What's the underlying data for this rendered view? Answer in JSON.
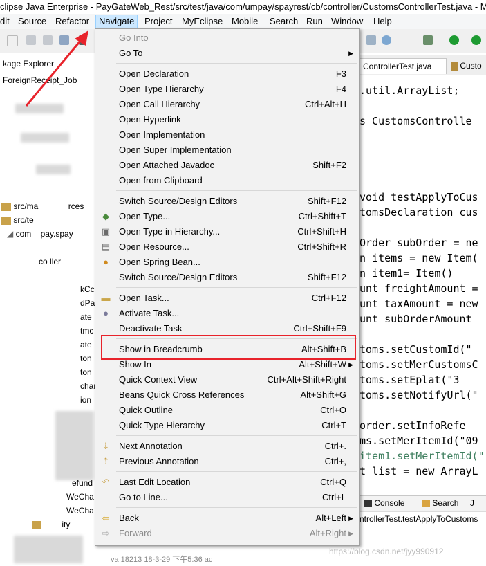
{
  "window": {
    "title": "clipse Java Enterprise - PayGateWeb_Rest/src/test/java/com/umpay/spayrest/cb/controller/CustomsControllerTest.java - M"
  },
  "menubar": {
    "items": [
      {
        "label": "dit"
      },
      {
        "label": "Source"
      },
      {
        "label": "Refactor"
      },
      {
        "label": "Navigate"
      },
      {
        "label": "Project"
      },
      {
        "label": "MyEclipse"
      },
      {
        "label": "Mobile"
      },
      {
        "label": "Search"
      },
      {
        "label": "Run"
      },
      {
        "label": "Window"
      },
      {
        "label": "Help"
      }
    ]
  },
  "package_explorer": {
    "tab_label": "kage Explorer",
    "project": "ForeignReceipt_Job",
    "rows": [
      {
        "label": "src/ma"
      },
      {
        "label": "rces"
      },
      {
        "label": "src/te"
      },
      {
        "label": "com"
      },
      {
        "label": "pay.spay"
      },
      {
        "label": "co"
      },
      {
        "label": "ller"
      },
      {
        "label": "kCc"
      },
      {
        "label": "dPa"
      },
      {
        "label": "ate"
      },
      {
        "label": "tmc"
      },
      {
        "label": "ate"
      },
      {
        "label": "ton"
      },
      {
        "label": "ton"
      },
      {
        "label": "char"
      },
      {
        "label": "ion"
      },
      {
        "label": "efund"
      },
      {
        "label": "WeCha"
      },
      {
        "label": "WeCha"
      },
      {
        "label": "ity"
      }
    ]
  },
  "editor": {
    "tabs": [
      {
        "label": "ControllerTest.java"
      },
      {
        "label": "Custo"
      }
    ],
    "lines": [
      ".util.ArrayList;",
      "s CustomsControlle",
      "void testApplyToCus",
      "tomsDeclaration cus",
      "Order subOrder = ne",
      "n items = new Item(",
      "n item1= Item()",
      "unt freightAmount =",
      "unt taxAmount = new",
      "unt subOrderAmount",
      "toms.setCustomId(\"",
      "toms.setMerCustomsC",
      "toms.setEplat(\"3",
      "toms.setNotifyUrl(\"",
      "order.setInfoRefe",
      "ms.setMerItemId(\"09",
      "item1.setMerItemId(\"",
      "t list = new ArrayL"
    ]
  },
  "console": {
    "tabs": [
      {
        "label": "Console"
      },
      {
        "label": "Search"
      },
      {
        "label": "J"
      }
    ],
    "line": "ntrollerTest.testApplyToCustoms"
  },
  "status": {
    "text": "va 18213 18-3-29 下午5:36 ac"
  },
  "watermark": "https://blog.csdn.net/jyy990912",
  "navigate_menu": {
    "groups": [
      [
        {
          "label": "Go Into",
          "shortcut": "",
          "disabled": true,
          "submenu": false,
          "icon": ""
        },
        {
          "label": "Go To",
          "shortcut": "",
          "disabled": false,
          "submenu": true,
          "icon": ""
        }
      ],
      [
        {
          "label": "Open Declaration",
          "shortcut": "F3",
          "icon": ""
        },
        {
          "label": "Open Type Hierarchy",
          "shortcut": "F4",
          "icon": ""
        },
        {
          "label": "Open Call Hierarchy",
          "shortcut": "Ctrl+Alt+H",
          "icon": ""
        },
        {
          "label": "Open Hyperlink",
          "shortcut": "",
          "icon": ""
        },
        {
          "label": "Open Implementation",
          "shortcut": "",
          "icon": ""
        },
        {
          "label": "Open Super Implementation",
          "shortcut": "",
          "icon": ""
        },
        {
          "label": "Open Attached Javadoc",
          "shortcut": "Shift+F2",
          "icon": ""
        },
        {
          "label": "Open from Clipboard",
          "shortcut": "",
          "icon": ""
        }
      ],
      [
        {
          "label": "Switch Source/Design Editors",
          "shortcut": "Shift+F12",
          "icon": ""
        },
        {
          "label": "Open Type...",
          "shortcut": "Ctrl+Shift+T",
          "icon": "open-type-icon"
        },
        {
          "label": "Open Type in Hierarchy...",
          "shortcut": "Ctrl+Shift+H",
          "icon": "type-hierarchy-icon"
        },
        {
          "label": "Open Resource...",
          "shortcut": "Ctrl+Shift+R",
          "icon": "open-resource-icon"
        },
        {
          "label": "Open Spring Bean...",
          "shortcut": "",
          "icon": "spring-bean-icon"
        },
        {
          "label": "Switch Source/Design Editors",
          "shortcut": "Shift+F12",
          "icon": ""
        }
      ],
      [
        {
          "label": "Open Task...",
          "shortcut": "Ctrl+F12",
          "icon": "open-task-icon"
        },
        {
          "label": "Activate Task...",
          "shortcut": "",
          "icon": "activate-task-icon"
        },
        {
          "label": "Deactivate Task",
          "shortcut": "Ctrl+Shift+F9",
          "icon": ""
        }
      ],
      [
        {
          "label": "Show in Breadcrumb",
          "shortcut": "Alt+Shift+B",
          "icon": ""
        },
        {
          "label": "Show In",
          "shortcut": "Alt+Shift+W",
          "submenu": true,
          "icon": ""
        },
        {
          "label": "Quick Context View",
          "shortcut": "Ctrl+Alt+Shift+Right",
          "icon": ""
        },
        {
          "label": "Beans Quick Cross References",
          "shortcut": "Alt+Shift+G",
          "icon": ""
        },
        {
          "label": "Quick Outline",
          "shortcut": "Ctrl+O",
          "icon": ""
        },
        {
          "label": "Quick Type Hierarchy",
          "shortcut": "Ctrl+T",
          "icon": ""
        }
      ],
      [
        {
          "label": "Next Annotation",
          "shortcut": "Ctrl+.",
          "icon": "next-annotation-icon"
        },
        {
          "label": "Previous Annotation",
          "shortcut": "Ctrl+,",
          "icon": "previous-annotation-icon"
        }
      ],
      [
        {
          "label": "Last Edit Location",
          "shortcut": "Ctrl+Q",
          "icon": "last-edit-icon"
        },
        {
          "label": "Go to Line...",
          "shortcut": "Ctrl+L",
          "icon": ""
        }
      ],
      [
        {
          "label": "Back",
          "shortcut": "Alt+Left",
          "submenu": true,
          "icon": "back-arrow-icon"
        },
        {
          "label": "Forward",
          "shortcut": "Alt+Right",
          "submenu": true,
          "disabled": true,
          "icon": "forward-arrow-icon"
        }
      ]
    ],
    "highlighted_item": "Show in Breadcrumb"
  },
  "colors": {
    "highlight_box": "#e8232b",
    "annotation_arrow": "#e8232b",
    "active_menu_bg": "#cce8ff"
  }
}
